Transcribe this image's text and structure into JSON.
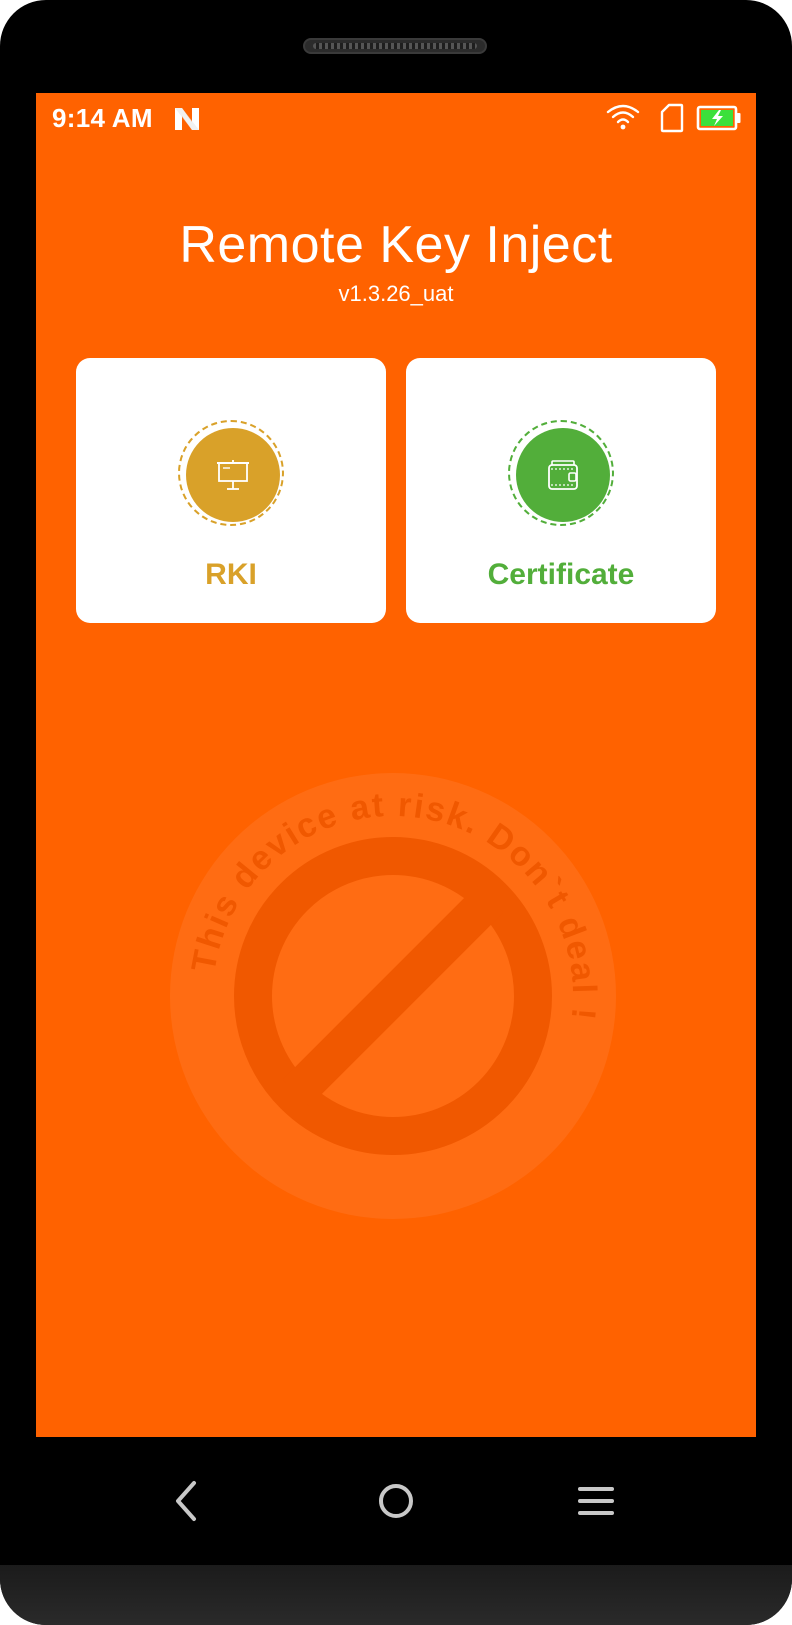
{
  "status_bar": {
    "time": "9:14 AM",
    "notification_icon": "n-logo-icon",
    "wifi_icon": "wifi-icon",
    "sim_icon": "sim-card-icon",
    "battery_icon": "battery-charging-icon"
  },
  "header": {
    "title": "Remote Key Inject",
    "version": "v1.3.26_uat"
  },
  "cards": [
    {
      "label": "RKI",
      "icon": "presentation-board-icon",
      "color": "#D9A129"
    },
    {
      "label": "Certificate",
      "icon": "wallet-icon",
      "color": "#52AE3A"
    }
  ],
  "watermark": {
    "text": "This device at risk. Don`t deal !"
  },
  "nav": {
    "back_icon": "back-icon",
    "home_icon": "home-icon",
    "menu_icon": "menu-icon"
  },
  "colors": {
    "screen_background": "#FF6200",
    "watermark_tone": "#F05800"
  }
}
